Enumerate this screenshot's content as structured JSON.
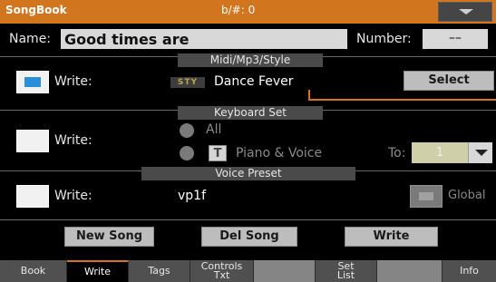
{
  "titlebar": {
    "app": "SongBook",
    "accidental": "b/#: 0"
  },
  "name_row": {
    "name_label": "Name:",
    "name_value": "Good times are",
    "number_label": "Number:",
    "number_value": "––"
  },
  "midi": {
    "section_title": "Midi/Mp3/Style",
    "write_label": "Write:",
    "write_checked": true,
    "type_badge": "STY",
    "style_name": "Dance Fever",
    "select_label": "Select"
  },
  "keyboard_set": {
    "section_title": "Keyboard Set",
    "write_label": "Write:",
    "write_checked": false,
    "all_label": "All",
    "t_badge": "T",
    "piano_voice_label": "Piano & Voice",
    "to_label": "To:",
    "to_value": "1"
  },
  "voice_preset": {
    "section_title": "Voice Preset",
    "write_label": "Write:",
    "write_checked": false,
    "preset_value": "vp1f",
    "global_label": "Global"
  },
  "actions": {
    "new_song": "New Song",
    "del_song": "Del Song",
    "write": "Write"
  },
  "tabs": [
    {
      "label": "Book",
      "active": false
    },
    {
      "label": "Write",
      "active": true
    },
    {
      "label": "Tags",
      "active": false
    },
    {
      "label": "Controls Txt",
      "active": false
    },
    {
      "label": "",
      "active": false
    },
    {
      "label": "Set List",
      "active": false
    },
    {
      "label": "",
      "active": false
    },
    {
      "label": "Info",
      "active": false
    }
  ],
  "colors": {
    "accent": "#d1761e",
    "check_blue": "#2a8fd8"
  }
}
